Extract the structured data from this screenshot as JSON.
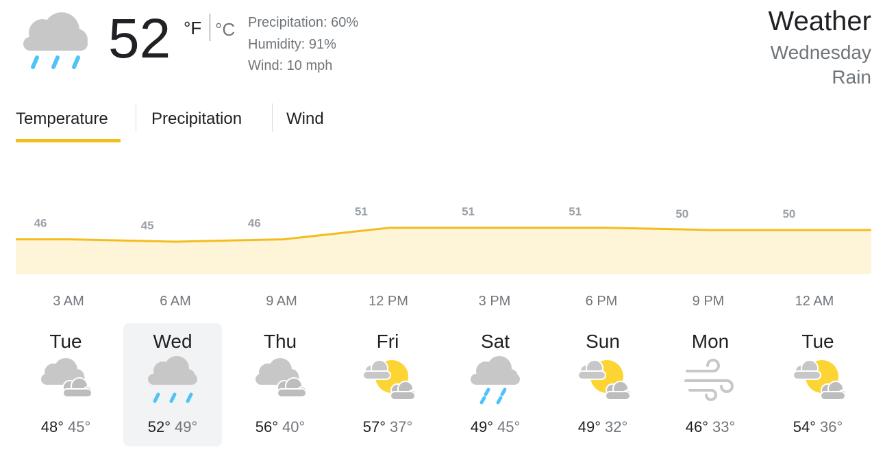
{
  "current": {
    "temperature": "52",
    "unit_f": "°F",
    "unit_c": "°C",
    "precipitation": "Precipitation: 60%",
    "humidity": "Humidity: 91%",
    "wind": "Wind: 10 mph",
    "icon": "rain-icon"
  },
  "header": {
    "title": "Weather",
    "day": "Wednesday",
    "condition": "Rain"
  },
  "tabs": [
    {
      "label": "Temperature",
      "selected": true
    },
    {
      "label": "Precipitation",
      "selected": false
    },
    {
      "label": "Wind",
      "selected": false
    }
  ],
  "colors": {
    "accent": "#f2bd1d",
    "chart_fill": "#fef4d7",
    "rain_drop": "#4fc3f7",
    "cloud": "#c7c7c7",
    "sun": "#fcd535"
  },
  "chart_data": {
    "type": "area",
    "x": [
      "3 AM",
      "6 AM",
      "9 AM",
      "12 PM",
      "3 PM",
      "6 PM",
      "9 PM",
      "12 AM"
    ],
    "values": [
      46,
      45,
      46,
      51,
      51,
      51,
      50,
      50
    ],
    "data_labels": [
      "46",
      "45",
      "46",
      "51",
      "51",
      "51",
      "50",
      "50"
    ],
    "grid": false
  },
  "times": [
    "3 AM",
    "6 AM",
    "9 AM",
    "12 PM",
    "3 PM",
    "6 PM",
    "9 PM",
    "12 AM"
  ],
  "forecast": [
    {
      "day": "Tue",
      "high": "48°",
      "low": "45°",
      "icon": "cloudy-icon",
      "selected": false
    },
    {
      "day": "Wed",
      "high": "52°",
      "low": "49°",
      "icon": "rain-icon",
      "selected": true
    },
    {
      "day": "Thu",
      "high": "56°",
      "low": "40°",
      "icon": "cloudy-icon",
      "selected": false
    },
    {
      "day": "Fri",
      "high": "57°",
      "low": "37°",
      "icon": "partly-cloudy-icon",
      "selected": false
    },
    {
      "day": "Sat",
      "high": "49°",
      "low": "45°",
      "icon": "showers-icon",
      "selected": false
    },
    {
      "day": "Sun",
      "high": "49°",
      "low": "32°",
      "icon": "partly-cloudy-icon",
      "selected": false
    },
    {
      "day": "Mon",
      "high": "46°",
      "low": "33°",
      "icon": "wind-icon",
      "selected": false
    },
    {
      "day": "Tue",
      "high": "54°",
      "low": "36°",
      "icon": "partly-cloudy-icon",
      "selected": false
    }
  ]
}
